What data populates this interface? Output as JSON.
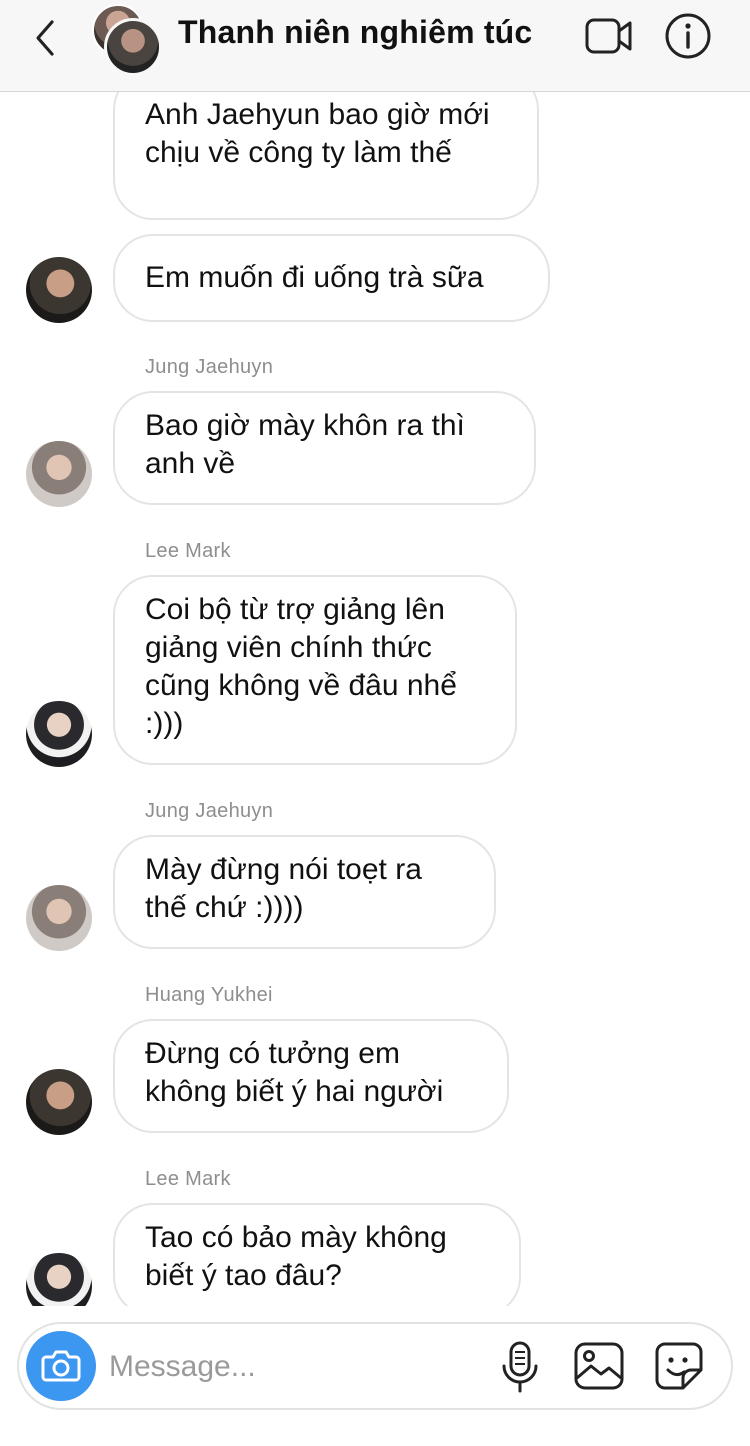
{
  "header": {
    "title": "Thanh niên nghiêm túc",
    "back_icon": "chevron-left-icon",
    "video_icon": "video-camera-icon",
    "info_icon": "info-icon"
  },
  "messages": [
    {
      "sender": "",
      "text": "Anh Jaehyun bao giờ mới chịu về công ty làm thế",
      "avatar": ""
    },
    {
      "sender": "",
      "text": "Em muốn đi uống trà sữa",
      "avatar": "Huang Yukhei"
    },
    {
      "sender": "Jung Jaehuyn",
      "text": "Bao giờ mày khôn ra thì anh về",
      "avatar": "Jung Jaehuyn"
    },
    {
      "sender": "Lee Mark",
      "text": "Coi bộ từ trợ giảng lên giảng viên chính thức cũng không về đâu nhể :)))",
      "avatar": "Lee Mark"
    },
    {
      "sender": "Jung Jaehuyn",
      "text": "Mày đừng nói toẹt ra thế chứ :))))",
      "avatar": "Jung Jaehuyn"
    },
    {
      "sender": "Huang Yukhei",
      "text": "Đừng có tưởng em không biết ý hai người",
      "avatar": "Huang Yukhei"
    },
    {
      "sender": "Lee Mark",
      "text": "Tao có bảo mày không biết ý tao đâu?",
      "avatar": "Lee Mark"
    }
  ],
  "composer": {
    "placeholder": "Message...",
    "value": "",
    "icons": [
      "camera-icon",
      "microphone-icon",
      "image-icon",
      "sticker-icon"
    ]
  },
  "colors": {
    "accent": "#3b97f0",
    "header_bg": "#f7f7f7",
    "bubble_border": "#e4e4e4",
    "sender_text": "#8e8e8e"
  }
}
